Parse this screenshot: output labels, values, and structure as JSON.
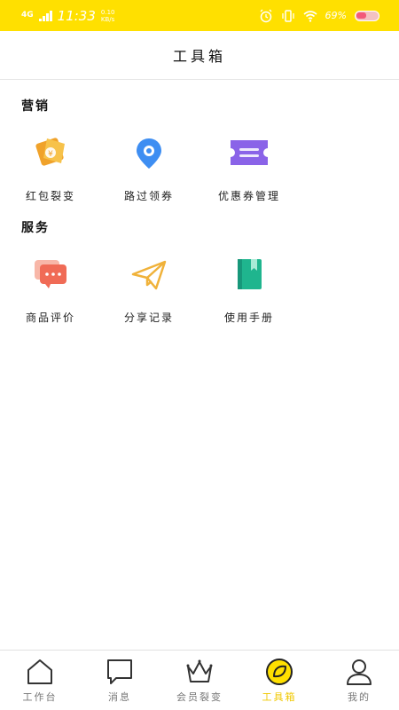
{
  "status_bar": {
    "network": "4G",
    "network_sup": "HD",
    "time": "11:33",
    "speed_value": "0.10",
    "speed_unit": "KB/s",
    "battery": "69%"
  },
  "header": {
    "title": "工具箱"
  },
  "sections": [
    {
      "title": "营销",
      "items": [
        {
          "label": "红包裂变",
          "icon": "red-packet-icon"
        },
        {
          "label": "路过领券",
          "icon": "location-pin-icon"
        },
        {
          "label": "优惠券管理",
          "icon": "coupon-icon"
        }
      ]
    },
    {
      "title": "服务",
      "items": [
        {
          "label": "商品评价",
          "icon": "chat-bubble-icon"
        },
        {
          "label": "分享记录",
          "icon": "paper-plane-icon"
        },
        {
          "label": "使用手册",
          "icon": "manual-book-icon"
        }
      ]
    }
  ],
  "bottom_nav": [
    {
      "label": "工作台",
      "icon": "home-icon",
      "active": false
    },
    {
      "label": "消息",
      "icon": "message-icon",
      "active": false
    },
    {
      "label": "会员裂变",
      "icon": "crown-icon",
      "active": false
    },
    {
      "label": "工具箱",
      "icon": "toolbox-icon",
      "active": true
    },
    {
      "label": "我的",
      "icon": "profile-icon",
      "active": false
    }
  ],
  "colors": {
    "accent": "#FFE000",
    "active_nav": "#F0C800",
    "coupon": "#8A63E8",
    "location": "#3E8EF2",
    "book": "#1FB58E",
    "chat": "#F06B56",
    "plane": "#F0B23A",
    "red_packet": "#F0A22A"
  }
}
